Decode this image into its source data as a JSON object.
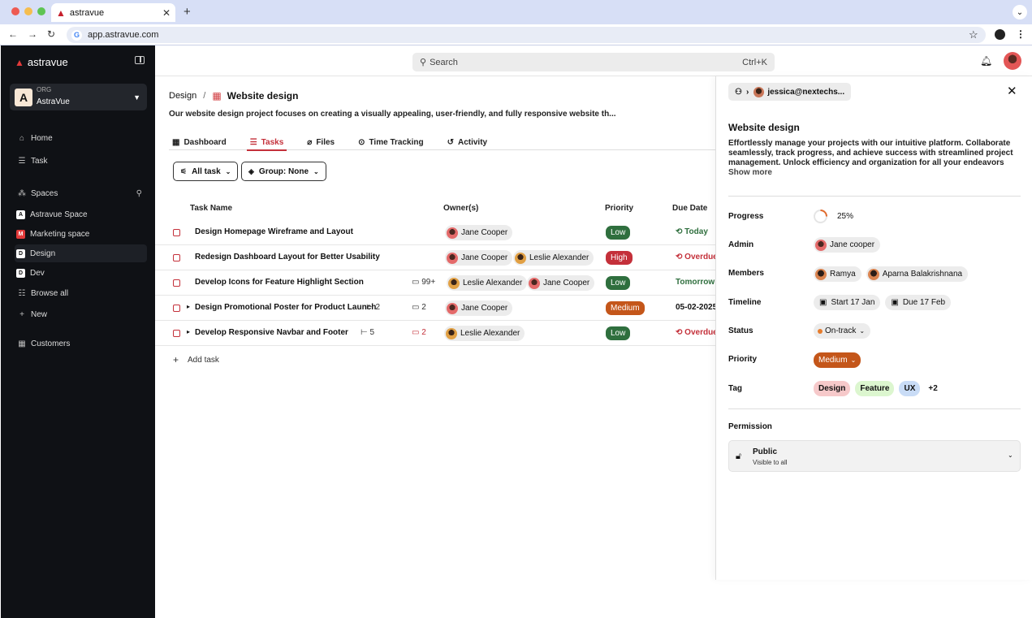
{
  "browser": {
    "tab_title": "astravue",
    "url": "app.astravue.com"
  },
  "sidebar": {
    "brand": "astravue",
    "org_label": "ORG",
    "org_name": "AstraVue",
    "org_initial": "A",
    "nav": [
      {
        "label": "Home",
        "icon": "home-icon"
      },
      {
        "label": "Task",
        "icon": "list-icon"
      }
    ],
    "spaces_label": "Spaces",
    "spaces": [
      {
        "label": "Astravue Space",
        "initial": "A",
        "color": "#ffffff"
      },
      {
        "label": "Marketing space",
        "initial": "M",
        "color": "#e23a3a"
      },
      {
        "label": "Design",
        "initial": "D",
        "color": "#ffffff"
      },
      {
        "label": "Dev",
        "initial": "D",
        "color": "#ffffff"
      }
    ],
    "browse_all": "Browse all",
    "new": "New",
    "customers": "Customers"
  },
  "topbar": {
    "search_placeholder": "Search",
    "shortcut": "Ctrl+K"
  },
  "page": {
    "breadcrumb_parent": "Design",
    "breadcrumb_sep": "/",
    "title": "Website design",
    "description": "Our website design project focuses on creating a visually appealing, user-friendly, and fully responsive website th...",
    "tabs": [
      {
        "label": "Dashboard",
        "icon": "grid-icon"
      },
      {
        "label": "Tasks",
        "icon": "list-icon"
      },
      {
        "label": "Files",
        "icon": "paperclip-icon"
      },
      {
        "label": "Time Tracking",
        "icon": "play-circle-icon"
      },
      {
        "label": "Activity",
        "icon": "history-icon"
      }
    ],
    "filters": {
      "all_task": "All task",
      "group": "Group: None"
    },
    "columns": [
      "Task Name",
      "Owner(s)",
      "Priority",
      "Due Date"
    ],
    "tasks": [
      {
        "name": "Design Homepage Wireframe and Layout",
        "subtasks": "",
        "comments": "",
        "owners": [
          "Jane Cooper"
        ],
        "priority": "Low",
        "due": "Today"
      },
      {
        "name": "Redesign Dashboard Layout for Better Usability",
        "subtasks": "",
        "comments": "",
        "owners": [
          "Jane Cooper",
          "Leslie Alexander"
        ],
        "priority": "High",
        "due": "Overdue"
      },
      {
        "name": "Develop Icons for Feature Highlight Section",
        "subtasks": "",
        "comments": "99+",
        "owners": [
          "Leslie Alexander",
          "Jane Cooper"
        ],
        "priority": "Low",
        "due": "Tomorrow"
      },
      {
        "name": "Design Promotional Poster for Product Launch",
        "subtasks": "2",
        "comments": "2",
        "owners": [
          "Jane Cooper"
        ],
        "priority": "Medium",
        "due": "05-02-2025"
      },
      {
        "name": "Develop Responsive Navbar and Footer",
        "subtasks": "5",
        "comments": "2",
        "owners": [
          "Leslie Alexander"
        ],
        "priority": "Low",
        "due": "Overdue"
      }
    ],
    "add_task": "Add task",
    "priority_colors": {
      "Low": "#2f6f3e",
      "High": "#c4303a",
      "Medium": "#c4561a"
    }
  },
  "panel": {
    "user": "jessica@nextechs...",
    "title": "Website design",
    "description": "Effortlessly manage your projects with our intuitive platform. Collaborate seamlessly, track progress, and achieve success with streamlined project management. Unlock efficiency and organization for all your endeavors",
    "show_more": "Show more",
    "labels": {
      "progress": "Progress",
      "admin": "Admin",
      "members": "Members",
      "timeline": "Timeline",
      "status": "Status",
      "priority": "Priority",
      "tag": "Tag",
      "permission": "Permission"
    },
    "progress": "25%",
    "progress_value": 0.25,
    "admin": "Jane cooper",
    "members": [
      "Ramya",
      "Aparna Balakrishnana"
    ],
    "timeline_start": "Start 17 Jan",
    "timeline_due": "Due 17 Feb",
    "status": "On-track",
    "priority": "Medium",
    "tags": [
      "Design",
      "Feature",
      "UX"
    ],
    "tags_more": "+2",
    "permission_title": "Public",
    "permission_sub": "Visible to all"
  }
}
